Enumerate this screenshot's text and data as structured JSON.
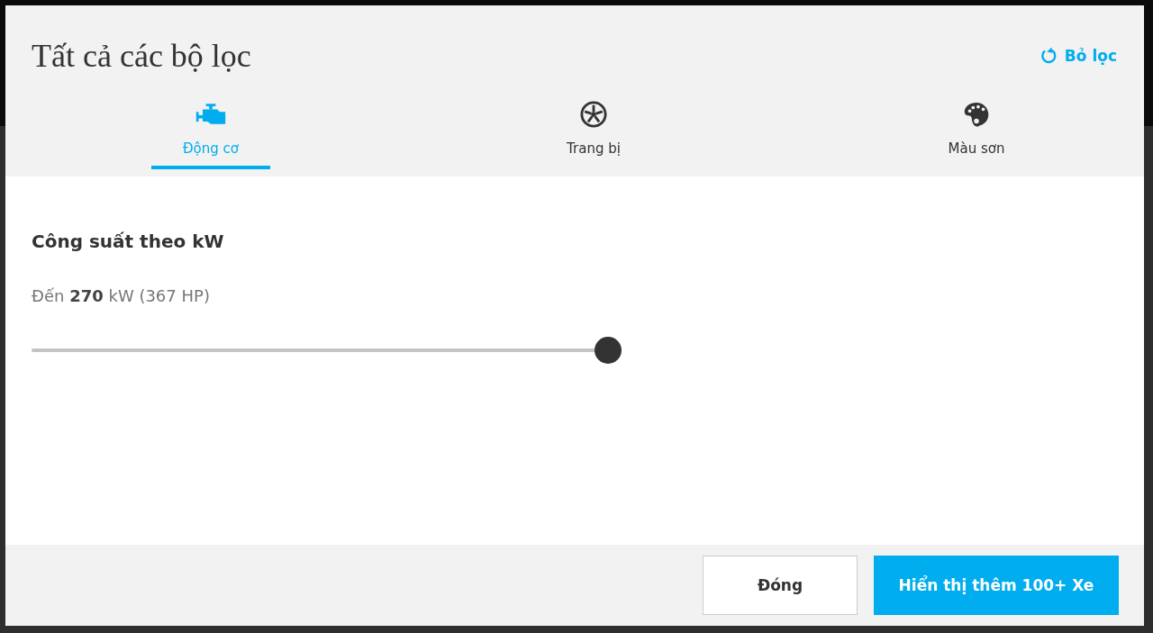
{
  "dialog": {
    "title": "Tất cả các bộ lọc",
    "reset_link": "Bỏ lọc"
  },
  "tabs": [
    {
      "label": "Động cơ",
      "kind": "engine",
      "selected": true
    },
    {
      "label": "Trang bị",
      "kind": "wheel",
      "selected": false
    },
    {
      "label": "Màu sơn",
      "kind": "palette",
      "selected": false
    }
  ],
  "filter": {
    "heading": "Công suất theo kW",
    "reading": "Đến **270** kW (367 HP)",
    "level": 1
  },
  "buttons": [
    {
      "label": "Đóng",
      "kind": "secondary"
    },
    {
      "label": "Hiển thị thêm 100+ Xe",
      "kind": "primary"
    }
  ]
}
